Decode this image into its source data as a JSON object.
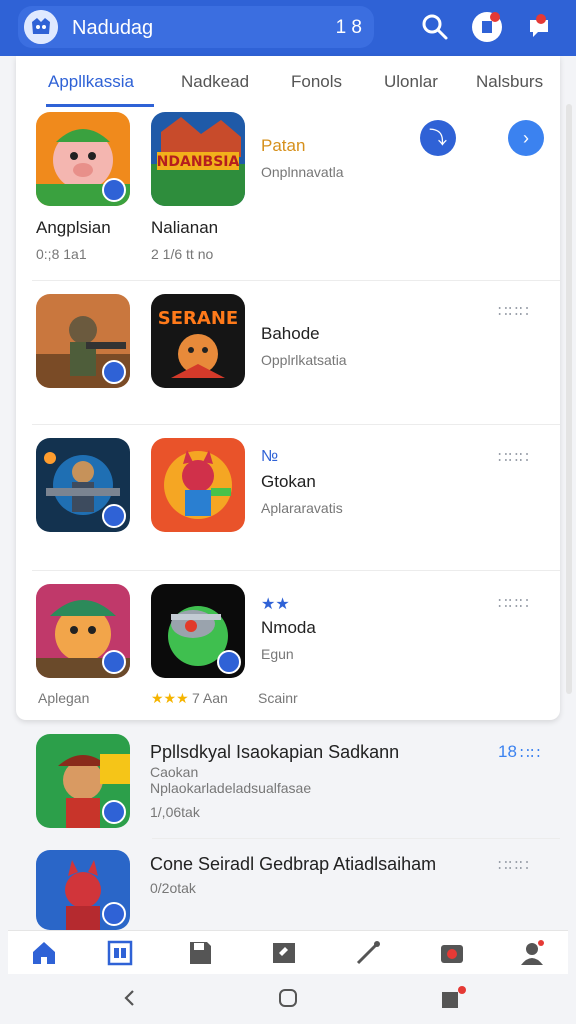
{
  "header": {
    "title": "Nadudag",
    "count": "1 8"
  },
  "tabs": [
    "Appllkassia",
    "Nadkead",
    "Fonols",
    "Ulonlar",
    "Nalsburs"
  ],
  "rows": [
    {
      "left": {
        "name": "Angplsian",
        "sub": "0:;8 1a1"
      },
      "mid": {
        "name": "Nalianan",
        "sub": "2 1/6 tt no"
      },
      "right": {
        "title": "Patan",
        "sub": "Onplnnavatla"
      }
    },
    {
      "right": {
        "title": "Bahode",
        "sub": "Opplrlkatsatia"
      }
    },
    {
      "right": {
        "title": "Gtokan",
        "sub": "Aplararavatis"
      }
    },
    {
      "left": {
        "sub": "Aplegan"
      },
      "mid": {
        "rating": "★★★",
        "sub": "7 Aan"
      },
      "right": {
        "stars": "★★",
        "title": "Nmoda",
        "sub": "Egun",
        "extra": "Scainr"
      }
    }
  ],
  "list": [
    {
      "title": "Ppllsdkyal  Isaokapian Sadkann",
      "line2": "Caokan",
      "line3": "Nplaokarladeladsualfasae",
      "meta": "1/,06tak",
      "count": "18"
    },
    {
      "title": "Cone Seiradl Gedbrap Atiadlsaiham",
      "meta": "0/2otak"
    }
  ],
  "colors": {
    "accent": "#2f62d6",
    "rating": "#f5b400",
    "title_orange": "#d6901b"
  },
  "icons": {
    "top": [
      "search-icon",
      "notification-icon",
      "chat-icon"
    ],
    "bottom_nav": [
      "home-icon",
      "apps-icon",
      "save-icon",
      "edit-icon",
      "tools-icon",
      "camera-icon",
      "profile-icon"
    ],
    "system": [
      "back-icon",
      "home-circle-icon",
      "recents-icon"
    ]
  }
}
